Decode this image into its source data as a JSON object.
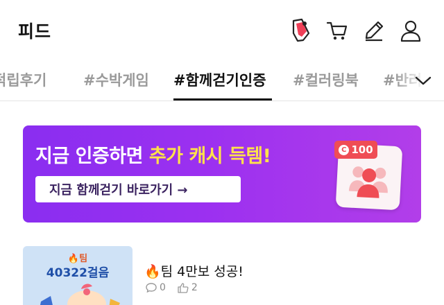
{
  "header": {
    "title": "피드",
    "icons": [
      "pedometer-icon",
      "cart-icon",
      "pencil-icon",
      "user-icon"
    ]
  },
  "tabs": [
    {
      "label": "적립후기",
      "active": false
    },
    {
      "label": "#수박게임",
      "active": false
    },
    {
      "label": "#함께걷기인증",
      "active": true
    },
    {
      "label": "#컬러링북",
      "active": false
    },
    {
      "label": "#반려동물",
      "active": false
    }
  ],
  "banner": {
    "headline_prefix": "지금 인증하면 ",
    "headline_highlight": "추가 캐시 득템!",
    "cta_label": "지금 함께걷기 바로가기 →",
    "coin_symbol": "C",
    "coin_amount": "100",
    "accent_color": "#ffe24a",
    "bg_color": "#9b30f0"
  },
  "feed": [
    {
      "thumb_team": "🔥팀",
      "thumb_steps": "40322걸음",
      "title": "🔥팀 4만보 성공!",
      "comments": "0",
      "likes": "2"
    }
  ]
}
